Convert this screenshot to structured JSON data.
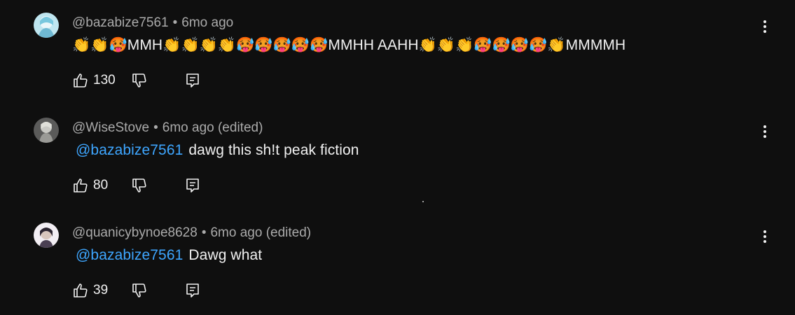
{
  "comments": [
    {
      "author": "@bazabize7561",
      "separator": "•",
      "time": "6mo ago",
      "mention": "",
      "text": "👏👏🥵MMH👏👏👏👏🥵🥵🥵🥵🥵MMHH AAHH👏👏👏🥵🥵🥵🥵👏MMMMH",
      "likes": "130",
      "avatar_color": "#9fd7e8"
    },
    {
      "author": "@WiseStove",
      "separator": "•",
      "time": "6mo ago (edited)",
      "mention": "@bazabize7561",
      "text": "dawg this sh!t peak fiction",
      "likes": "80",
      "avatar_color": "#8a8a88"
    },
    {
      "author": "@quanicybynoe8628",
      "separator": "•",
      "time": "6mo ago (edited)",
      "mention": "@bazabize7561",
      "text": "Dawg what",
      "likes": "39",
      "avatar_color": "#e9e4ea"
    }
  ],
  "colors": {
    "background": "#0f0f0f",
    "mention": "#3ea6ff",
    "meta": "#aaaaaa",
    "text": "#f1f1f1"
  },
  "icons": {
    "like": "thumbs-up-icon",
    "dislike": "thumbs-down-icon",
    "reply": "reply-icon",
    "more": "more-vert-icon"
  }
}
